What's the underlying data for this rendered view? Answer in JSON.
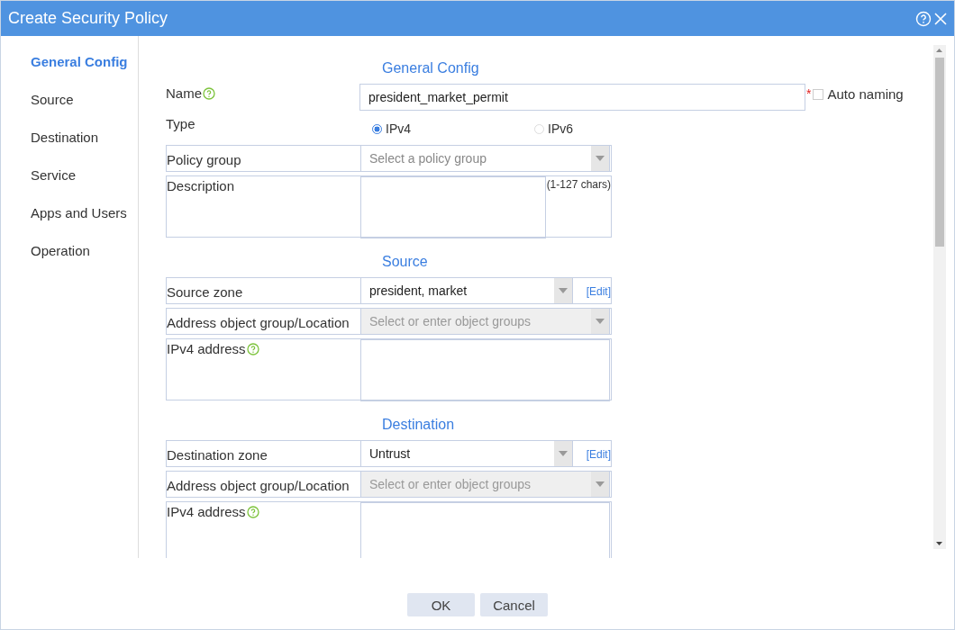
{
  "window": {
    "title": "Create Security Policy"
  },
  "nav": [
    {
      "label": "General Config",
      "selected": true
    },
    {
      "label": "Source",
      "selected": false
    },
    {
      "label": "Destination",
      "selected": false
    },
    {
      "label": "Service",
      "selected": false
    },
    {
      "label": "Apps and Users",
      "selected": false
    },
    {
      "label": "Operation",
      "selected": false
    }
  ],
  "sections": [
    {
      "title": "General Config",
      "fields": [
        {
          "kind": "text",
          "label": "Name",
          "help": true,
          "value": "president_market_permit",
          "required_mark": "*",
          "checkbox": {
            "label": "Auto naming",
            "checked": false
          }
        },
        {
          "kind": "radio",
          "label": "Type",
          "help": false,
          "options": [
            {
              "label": "IPv4",
              "selected": true
            },
            {
              "label": "IPv6",
              "selected": false
            }
          ]
        },
        {
          "kind": "select",
          "label": "Policy group",
          "help": false,
          "placeholder": "Select a policy group",
          "disabled": false
        },
        {
          "kind": "textarea",
          "label": "Description",
          "help": false,
          "hint": "(1-127 chars)"
        }
      ]
    },
    {
      "title": "Source",
      "fields": [
        {
          "kind": "select",
          "label": "Source zone",
          "help": false,
          "value": "president, market",
          "disabled": false,
          "link": "[Edit]"
        },
        {
          "kind": "select",
          "label": "Address object group/Location",
          "help": false,
          "placeholder": "Select or enter object groups",
          "disabled": true
        },
        {
          "kind": "textarea",
          "label": "IPv4 address",
          "help": true
        }
      ]
    },
    {
      "title": "Destination",
      "fields": [
        {
          "kind": "select",
          "label": "Destination zone",
          "help": false,
          "value": "Untrust",
          "disabled": false,
          "link": "[Edit]"
        },
        {
          "kind": "select",
          "label": "Address object group/Location",
          "help": false,
          "placeholder": "Select or enter object groups",
          "disabled": true
        },
        {
          "kind": "textarea",
          "label": "IPv4 address",
          "help": true
        }
      ]
    }
  ],
  "buttons": [
    "OK",
    "Cancel"
  ]
}
